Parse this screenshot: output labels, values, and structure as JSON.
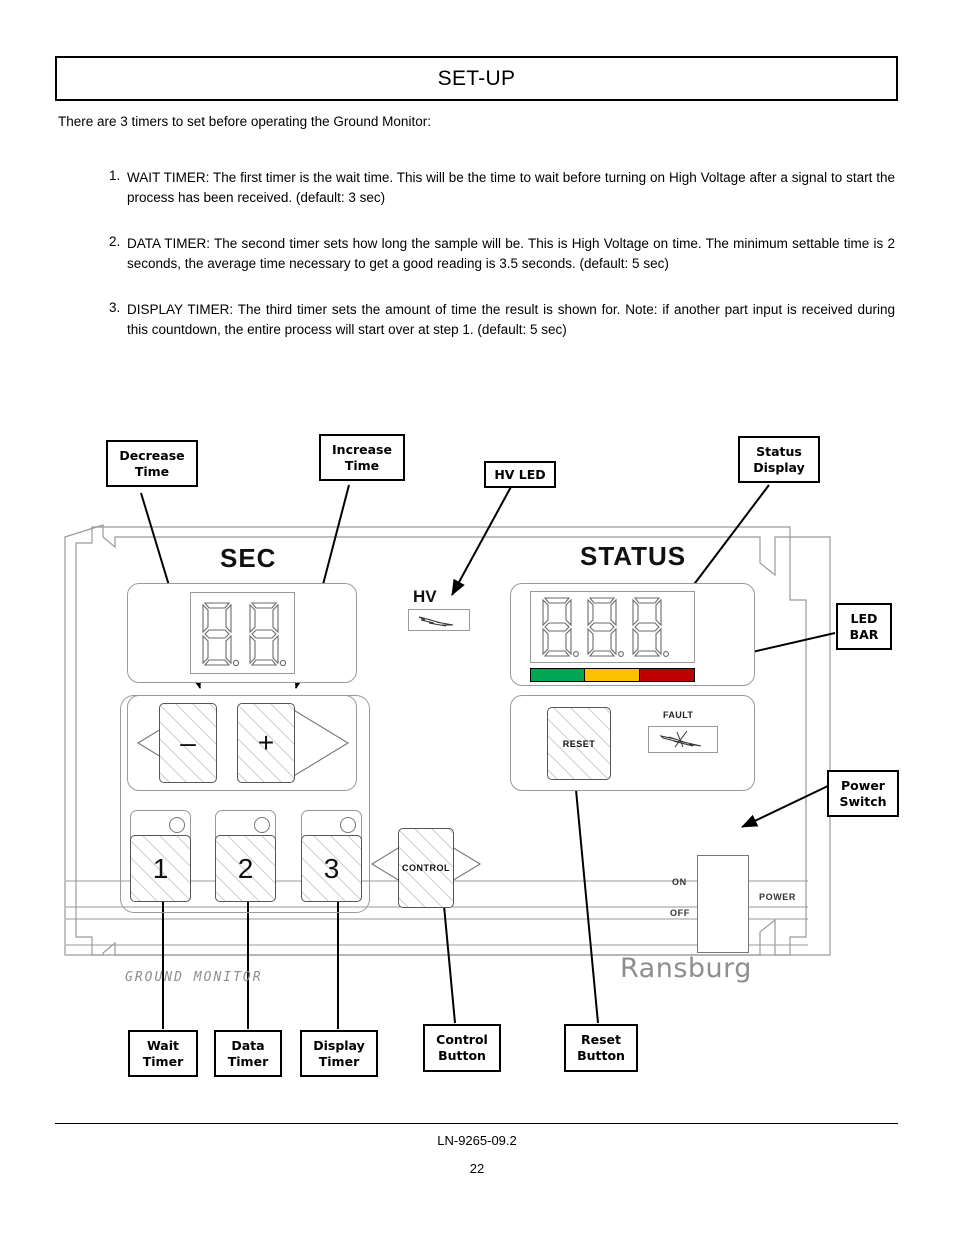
{
  "header": {
    "title": "SET-UP"
  },
  "intro": "There are 3 timers to set before operating the  Ground Monitor:",
  "list": [
    {
      "num": "1.",
      "text": "WAIT TIMER:  The first timer is the wait time. This will be the time to wait before turning on High Voltage after a signal to start the process has been received. (default: 3 sec)"
    },
    {
      "num": "2.",
      "text": "DATA TIMER:  The second timer sets how long the sample will be. This is High Voltage on time.  The minimum settable time is 2 seconds, the average time necessary to get a good reading is 3.5 seconds. (default: 5 sec)"
    },
    {
      "num": "3.",
      "text": "DISPLAY TIMER:  The third timer sets the amount of time the result is shown for. Note: if another part input is received during this countdown, the entire process will start over at step 1. (default: 5 sec)"
    }
  ],
  "callouts": {
    "decrease_time": {
      "line1": "Decrease",
      "line2": "Time"
    },
    "increase_time": {
      "line1": "Increase",
      "line2": "Time"
    },
    "hv_led": {
      "line1": "HV LED",
      "line2": ""
    },
    "status_display": {
      "line1": "Status",
      "line2": "Display"
    },
    "led_bar": {
      "line1": "LED",
      "line2": "BAR"
    },
    "power_switch": {
      "line1": "Power",
      "line2": "Switch"
    },
    "wait_timer": {
      "line1": "Wait",
      "line2": "Timer"
    },
    "data_timer": {
      "line1": "Data",
      "line2": "Timer"
    },
    "display_timer": {
      "line1": "Display",
      "line2": "Timer"
    },
    "control_button": {
      "line1": "Control",
      "line2": "Button"
    },
    "reset_button": {
      "line1": "Reset",
      "line2": "Button"
    }
  },
  "panel": {
    "sec_title": "SEC",
    "status_title": "STATUS",
    "sec_digits": "88",
    "status_digits": "888",
    "hv_label": "HV",
    "fault_label": "FAULT",
    "reset_label": "RESET",
    "control_label": "CONTROL",
    "minus_label": "–",
    "plus_label": "+",
    "preset_buttons": [
      "1",
      "2",
      "3"
    ],
    "power_on": "ON",
    "power_off": "OFF",
    "power_label": "POWER",
    "brand": "Ransburg",
    "model_text": "GROUND MONITOR",
    "led_bar_colors": [
      "#00a651",
      "#fcc200",
      "#c00000"
    ]
  },
  "footer": {
    "doc": "LN-9265-09.2",
    "page": "22"
  }
}
